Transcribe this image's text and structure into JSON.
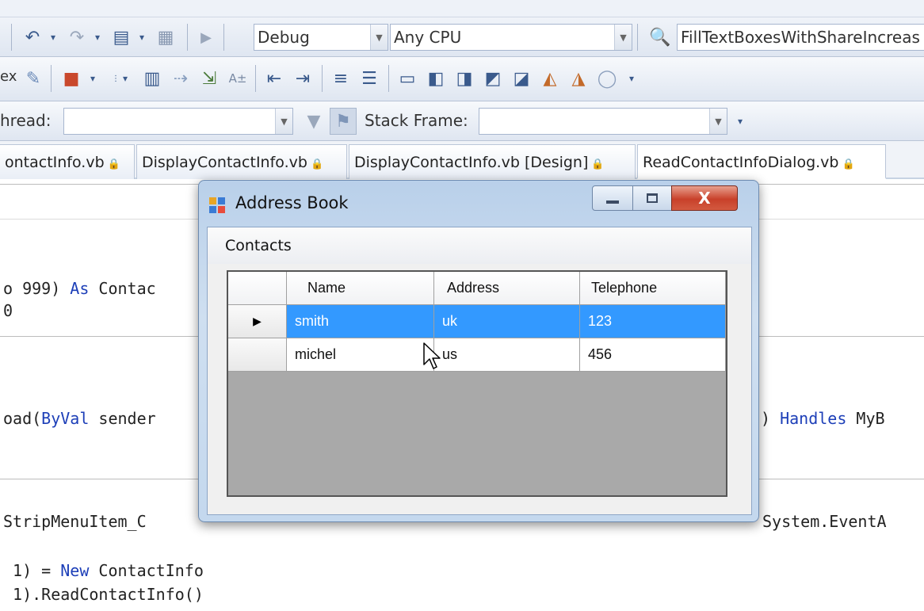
{
  "toolbar1": {
    "config_combo": "Debug",
    "platform_combo": "Any CPU",
    "find_combo": "FillTextBoxesWithShareIncreas"
  },
  "toolbar3": {
    "thread_label": "hread:",
    "stack_frame_label": "Stack Frame:"
  },
  "tabs": [
    {
      "label": "ontactInfo.vb"
    },
    {
      "label": "DisplayContactInfo.vb"
    },
    {
      "label": "DisplayContactInfo.vb [Design]"
    },
    {
      "label": "ReadContactInfoDialog.vb"
    }
  ],
  "tab_lock_glyph": "🔒",
  "code": {
    "line1_pre": "o 999) ",
    "line1_kw": "As",
    "line1_post": " Contac",
    "line2": "0",
    "line3_pre": "oad(",
    "line3_kw": "ByVal",
    "line3_post": " sender",
    "line3_right_pre": ") ",
    "line3_right_kw": "Handles",
    "line3_right_post": " MyB",
    "line4_pre": "StripMenuItem_C",
    "line4_right": "System.EventA",
    "line5_pre": " 1) = ",
    "line5_kw": "New",
    "line5_post": " ContactInfo",
    "line6": " 1).ReadContactInfo()"
  },
  "dialog": {
    "title": "Address Book",
    "close_glyph": "X",
    "menu": {
      "contacts": "Contacts"
    },
    "grid": {
      "columns": [
        "Name",
        "Address",
        "Telephone"
      ],
      "rows": [
        {
          "name": "smith",
          "address": "uk",
          "telephone": "123",
          "selected": true
        },
        {
          "name": "michel",
          "address": "us",
          "telephone": "456",
          "selected": false
        }
      ],
      "current_row_glyph": "▶"
    }
  },
  "colors": {
    "selection": "#3399ff",
    "keyword": "#1d3fb8",
    "close_button": "#c8402a"
  }
}
